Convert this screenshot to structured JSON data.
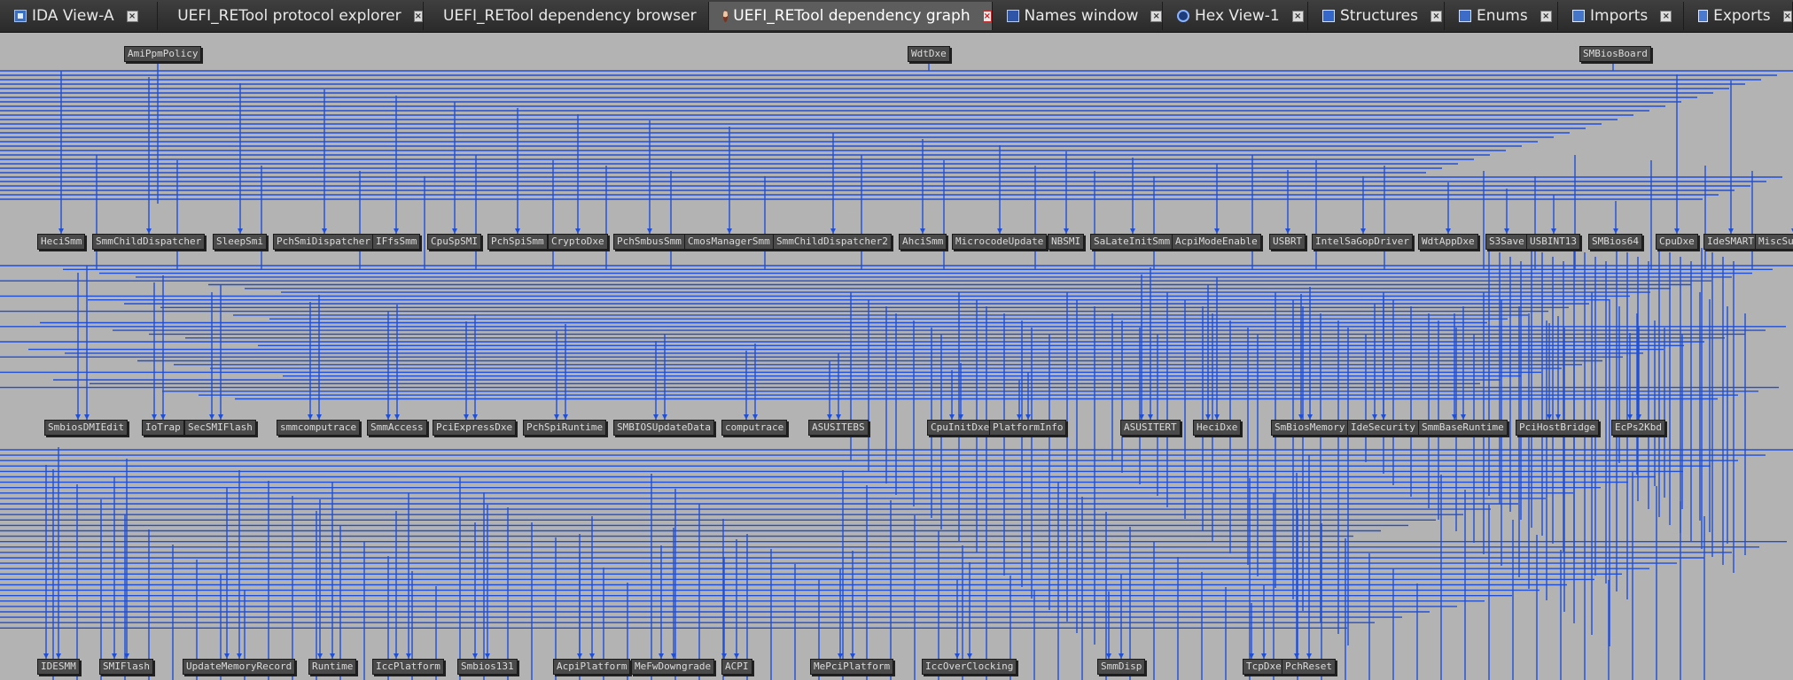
{
  "tabs": [
    {
      "label": "IDA View-A",
      "icon": "ida-view-icon",
      "kind": "ida",
      "active": false
    },
    {
      "label": "UEFI_RETool protocol explorer",
      "icon": "retool-avatar-icon",
      "kind": "avatar",
      "active": false
    },
    {
      "label": "UEFI_RETool dependency browser",
      "icon": "retool-avatar-icon",
      "kind": "avatar",
      "active": false
    },
    {
      "label": "UEFI_RETool dependency graph",
      "icon": "retool-avatar-icon",
      "kind": "avatar",
      "active": true
    },
    {
      "label": "Names window",
      "icon": "names-window-icon",
      "kind": "names",
      "active": false
    },
    {
      "label": "Hex View-1",
      "icon": "hex-view-icon",
      "kind": "hex",
      "active": false
    },
    {
      "label": "Structures",
      "icon": "structures-icon",
      "kind": "struct",
      "active": false
    },
    {
      "label": "Enums",
      "icon": "enums-icon",
      "kind": "enums",
      "active": false
    },
    {
      "label": "Imports",
      "icon": "imports-icon",
      "kind": "imports",
      "active": false
    },
    {
      "label": "Exports",
      "icon": "exports-icon",
      "kind": "exports",
      "active": false
    }
  ],
  "graph": {
    "edge_color": "#1f4fd6",
    "node_color": "#4a4a4a",
    "background": "#b3b3b3",
    "rows": [
      [
        "AmiPpmPolicy",
        "WdtDxe",
        "SMBiosBoard"
      ],
      [
        "HeciSmm",
        "SmmChildDispatcher",
        "SleepSmi",
        "PchSmiDispatcher",
        "IFfsSmm",
        "CpuSpSMI",
        "PchSpiSmm",
        "CryptoDxe",
        "PchSmbusSmm",
        "CmosManagerSmm",
        "SmmChildDispatcher2",
        "AhciSmm",
        "MicrocodeUpdate",
        "NBSMI",
        "SaLateInitSmm",
        "AcpiModeEnable",
        "USBRT",
        "IntelSaGopDriver",
        "WdtAppDxe",
        "S3Save",
        "USBINT13",
        "SMBios64",
        "CpuDxe",
        "IdeSMART",
        "MiscSubclass"
      ],
      [
        "SmbiosDMIEdit",
        "IoTrap",
        "SecSMIFlash",
        "smmcomputrace",
        "SmmAccess",
        "PciExpressDxe",
        "PchSpiRuntime",
        "SMBIOSUpdateData",
        "computrace",
        "ASUSITEBS",
        "CpuInitDxe",
        "PlatformInfo",
        "ASUSITERT",
        "HeciDxe",
        "SmBiosMemory",
        "IdeSecurity",
        "SmmBaseRuntime",
        "PciHostBridge",
        "EcPs2Kbd"
      ],
      [
        "IDESMM",
        "SMIFlash",
        "UpdateMemoryRecord",
        "Runtime",
        "IccPlatform",
        "Smbios131",
        "AcpiPlatform",
        "MeFwDowngrade",
        "ACPI",
        "MePciPlatform",
        "IccOverClocking",
        "SmmDisp",
        "TcpDxe",
        "PchReset"
      ]
    ]
  }
}
